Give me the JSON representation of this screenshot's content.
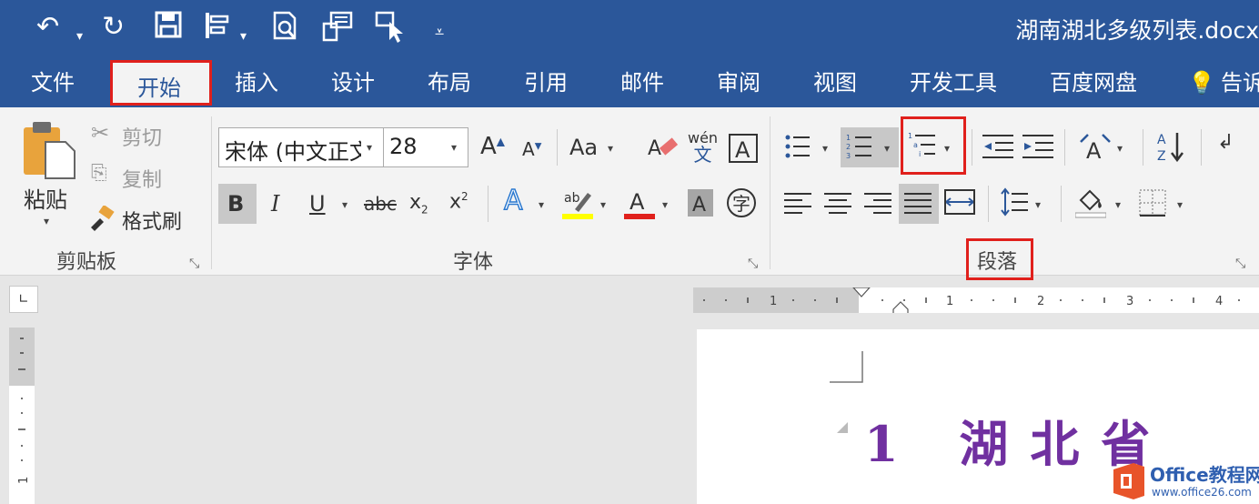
{
  "window": {
    "title": "湖南湖北多级列表.docx"
  },
  "quick_access": [
    "undo-icon",
    "redo-icon",
    "save-icon",
    "format-painter-icon",
    "print-preview-icon",
    "touch-mode-icon",
    "customize-icon"
  ],
  "tabs": [
    "文件",
    "开始",
    "插入",
    "设计",
    "布局",
    "引用",
    "邮件",
    "审阅",
    "视图",
    "开发工具",
    "百度网盘"
  ],
  "tell_me": "告诉",
  "clipboard": {
    "paste": "粘贴",
    "cut": "剪切",
    "copy": "复制",
    "format_painter": "格式刷",
    "group": "剪贴板"
  },
  "font": {
    "name": "宋体 (中文正文",
    "size": "28",
    "change_case": "Aa",
    "group": "字体",
    "phonetic": "wén"
  },
  "paragraph": {
    "group": "段落"
  },
  "document": {
    "heading_number": "1",
    "heading_text": "湖北省"
  },
  "watermark": {
    "brand": "Office教程网",
    "url": "www.office26.com"
  },
  "colors": {
    "accent": "#2b579a",
    "highlight_red": "#e0201c",
    "heading": "#7030a0",
    "font_color": "#e0201c",
    "highlight_yellow": "#ffff00"
  }
}
